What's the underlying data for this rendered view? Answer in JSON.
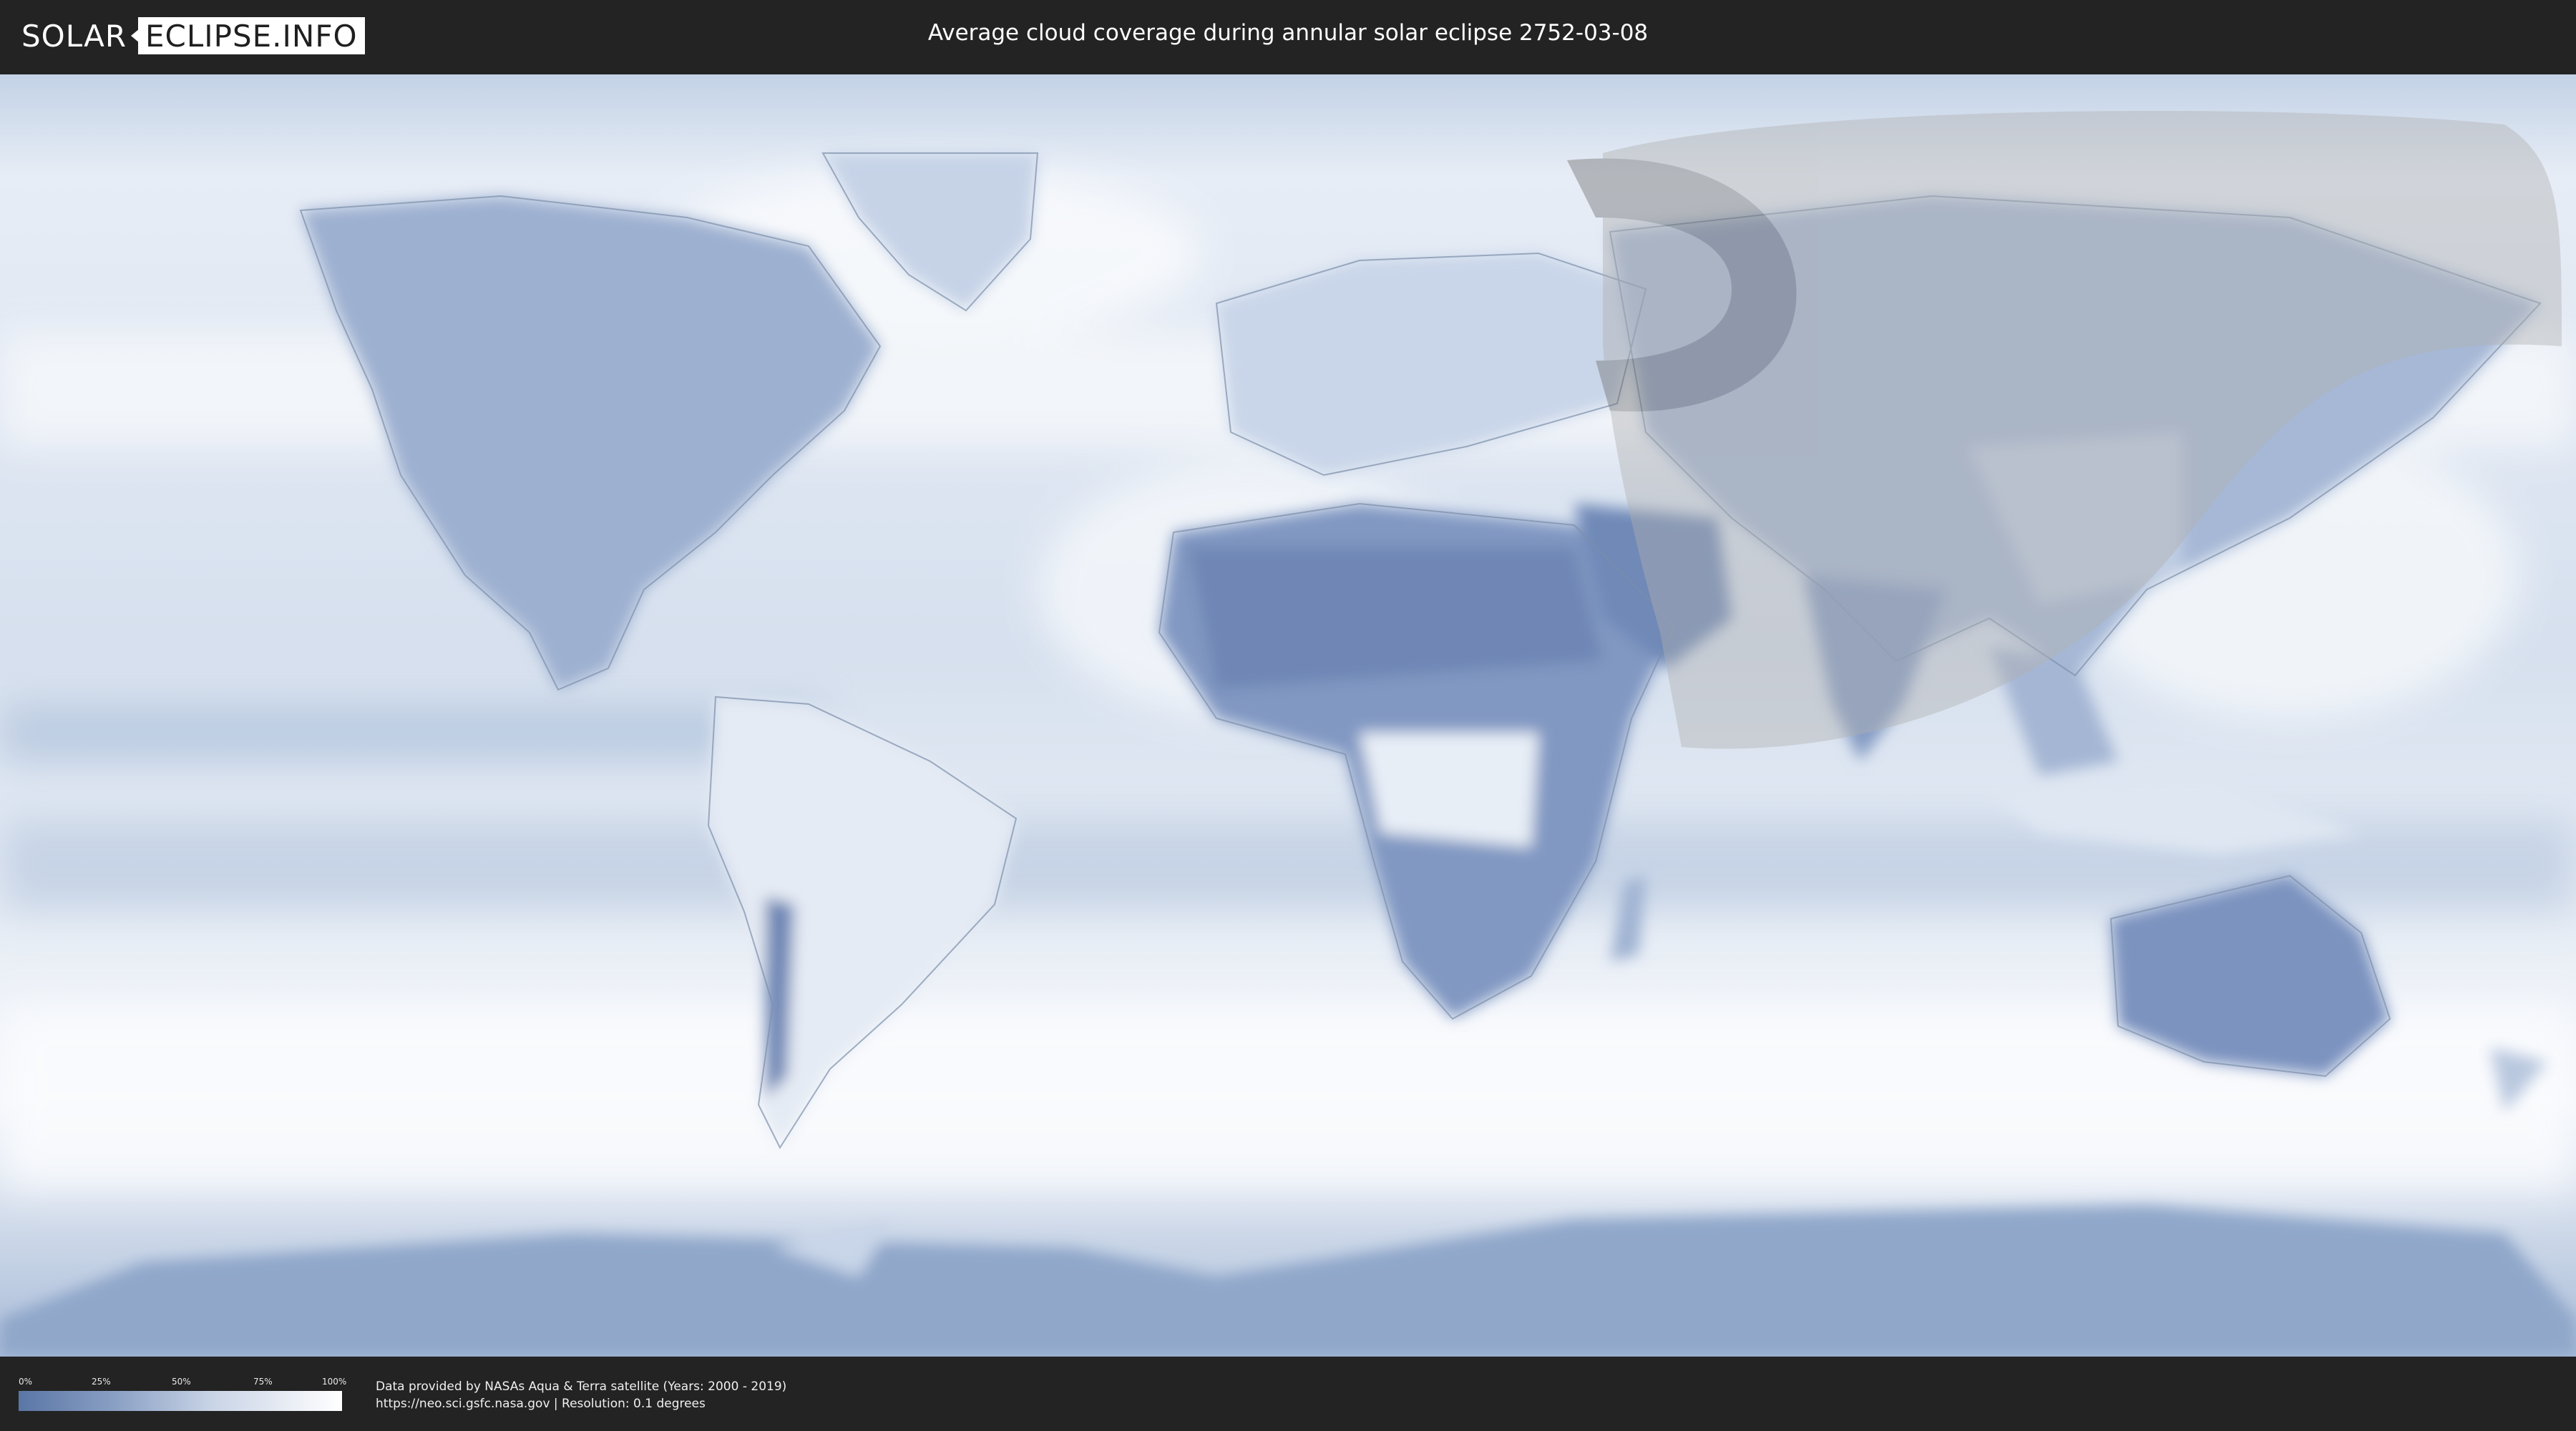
{
  "logo": {
    "left": "SOLAR",
    "right": "ECLIPSE.INFO"
  },
  "title": "Average cloud coverage during annular solar eclipse 2752-03-08",
  "legend": {
    "ticks": [
      "0%",
      "25%",
      "50%",
      "75%",
      "100%"
    ],
    "colors": {
      "low": "#5a76a6",
      "high": "#ffffff"
    }
  },
  "credits": {
    "line1": "Data provided by NASAs Aqua & Terra satellite (Years: 2000 - 2019)",
    "line2": "https://neo.sci.gsfc.nasa.gov | Resolution: 0.1 degrees"
  },
  "map": {
    "colors": {
      "ocean": "#dde6f1",
      "land": "#8097c0",
      "dry": "#6f87b5",
      "cloudy": "#f4f7fb",
      "path": "#9a9a9a"
    }
  }
}
